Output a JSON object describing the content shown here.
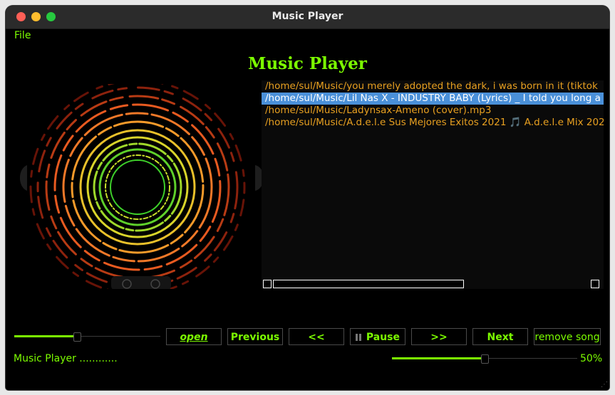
{
  "window": {
    "title": "Music Player"
  },
  "menu": {
    "file_label": "File"
  },
  "app": {
    "title": "Music Player"
  },
  "playlist": {
    "items": [
      "/home/sul/Music/you merely adopted the dark, i was born in it (tiktok",
      "/home/sul/Music/Lil Nas X - INDUSTRY BABY (Lyrics) _ I told you long a",
      "/home/sul/Music/Ladynsax-Ameno (cover).mp3",
      "/home/sul/Music/A.d.e.l.e Sus Mejores Exitos 2021 🎵 A.d.e.l.e Mix 202"
    ],
    "selected_index": 1
  },
  "playback": {
    "progress": 0.43
  },
  "controls": {
    "open_label": "open",
    "previous_label": "Previous",
    "rewind_label": "<<",
    "pause_label": "Pause",
    "forward_label": ">>",
    "next_label": "Next",
    "remove_label": "remove song"
  },
  "status": {
    "text": "Music Player ............"
  },
  "volume": {
    "value": 0.5,
    "label": "50%"
  },
  "colors": {
    "accent": "#7CFC00",
    "playlist_text": "#e8a020",
    "selection": "#4a90d9"
  }
}
